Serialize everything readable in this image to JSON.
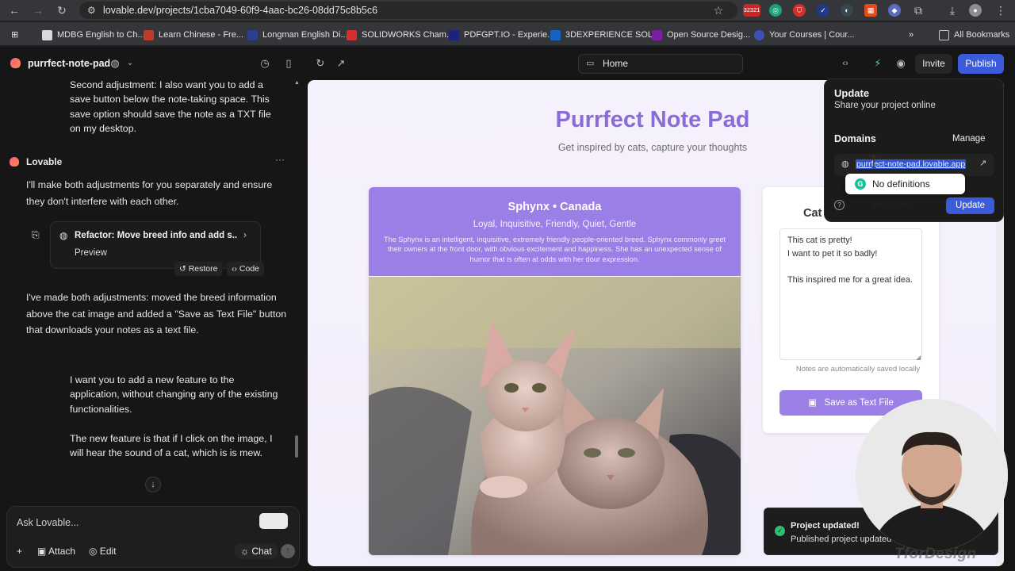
{
  "browser": {
    "url": "lovable.dev/projects/1cba7049-60f9-4aac-bc26-08dd75c8b5c6",
    "extension_badge": "32321",
    "bookmarks": [
      {
        "label": "MDBG English to Ch...",
        "color": "#d9d9d9"
      },
      {
        "label": "Learn Chinese - Fre...",
        "color": "#c0392b"
      },
      {
        "label": "Longman English Di...",
        "color": "#2c3e8f"
      },
      {
        "label": "SOLIDWORKS Cham...",
        "color": "#d32f2f"
      },
      {
        "label": "PDFGPT.IO - Experie...",
        "color": "#1a237e"
      },
      {
        "label": "3DEXPERIENCE SOL...",
        "color": "#1565c0"
      },
      {
        "label": "Open Source Desig...",
        "color": "#7b1fa2"
      },
      {
        "label": "Your Courses | Cour...",
        "color": "#3f51b5"
      }
    ],
    "all_bookmarks": "All Bookmarks"
  },
  "app": {
    "project_name": "purrfect-note-pad",
    "preview_route": "Home",
    "invite_label": "Invite",
    "publish_label": "Publish"
  },
  "chat": {
    "user_msg_1": "Second adjustment: I also want you to add a save button below the note-taking space. This save option should save the note as a TXT file on my desktop.",
    "assistant_name": "Lovable",
    "ai_msg_1": "I'll make both adjustments for you separately and ensure they don't interfere with each other.",
    "card_title": "Refactor: Move breed info and add s...",
    "card_subtitle": "Preview",
    "restore_label": "Restore",
    "code_label": "Code",
    "ai_msg_2": "I've made both adjustments: moved the breed information above the cat image and added a \"Save as Text File\" button that downloads your notes as a text file.",
    "user_msg_2a": "I want you to add a new feature to the application, without changing any of the existing functionalities.",
    "user_msg_2b": "The new feature is that if I click on the image, I will hear the sound of a cat, which is is mew.",
    "composer_placeholder": "Ask Lovable...",
    "attach_label": "Attach",
    "edit_label": "Edit",
    "chat_label": "Chat"
  },
  "site": {
    "title": "Purrfect Note Pad",
    "subtitle": "Get inspired by cats, capture your thoughts",
    "breed_name": "Sphynx • Canada",
    "breed_traits": "Loyal, Inquisitive, Friendly, Quiet, Gentle",
    "breed_desc": "The Sphynx is an intelligent, inquisitive, extremely friendly people-oriented breed. Sphynx commonly greet their owners at the front door, with obvious excitement and happiness. She has an unexpected sense of humor that is often at odds with her dour expression.",
    "notes_title": "Cat",
    "notes_text": "This cat is pretty!\nI want to pet it so badly!\n\nThis inspired me for a great idea.",
    "notes_hint": "Notes are automatically saved locally",
    "save_label": "Save as Text File"
  },
  "popover": {
    "title": "Update",
    "subtitle": "Share your project online",
    "domains_label": "Domains",
    "manage_label": "Manage",
    "domain": "purrfect-note-pad.lovable.app",
    "tooltip": "No definitions available.",
    "update_label": "Update"
  },
  "toast": {
    "title": "Project updated!",
    "subtitle": "Published project updated"
  },
  "watermark": "TforDesign",
  "colors": {
    "accent_purple": "#9b7fe6",
    "publish_blue": "#3b5bdb",
    "title_purple": "#8a6cd8"
  }
}
